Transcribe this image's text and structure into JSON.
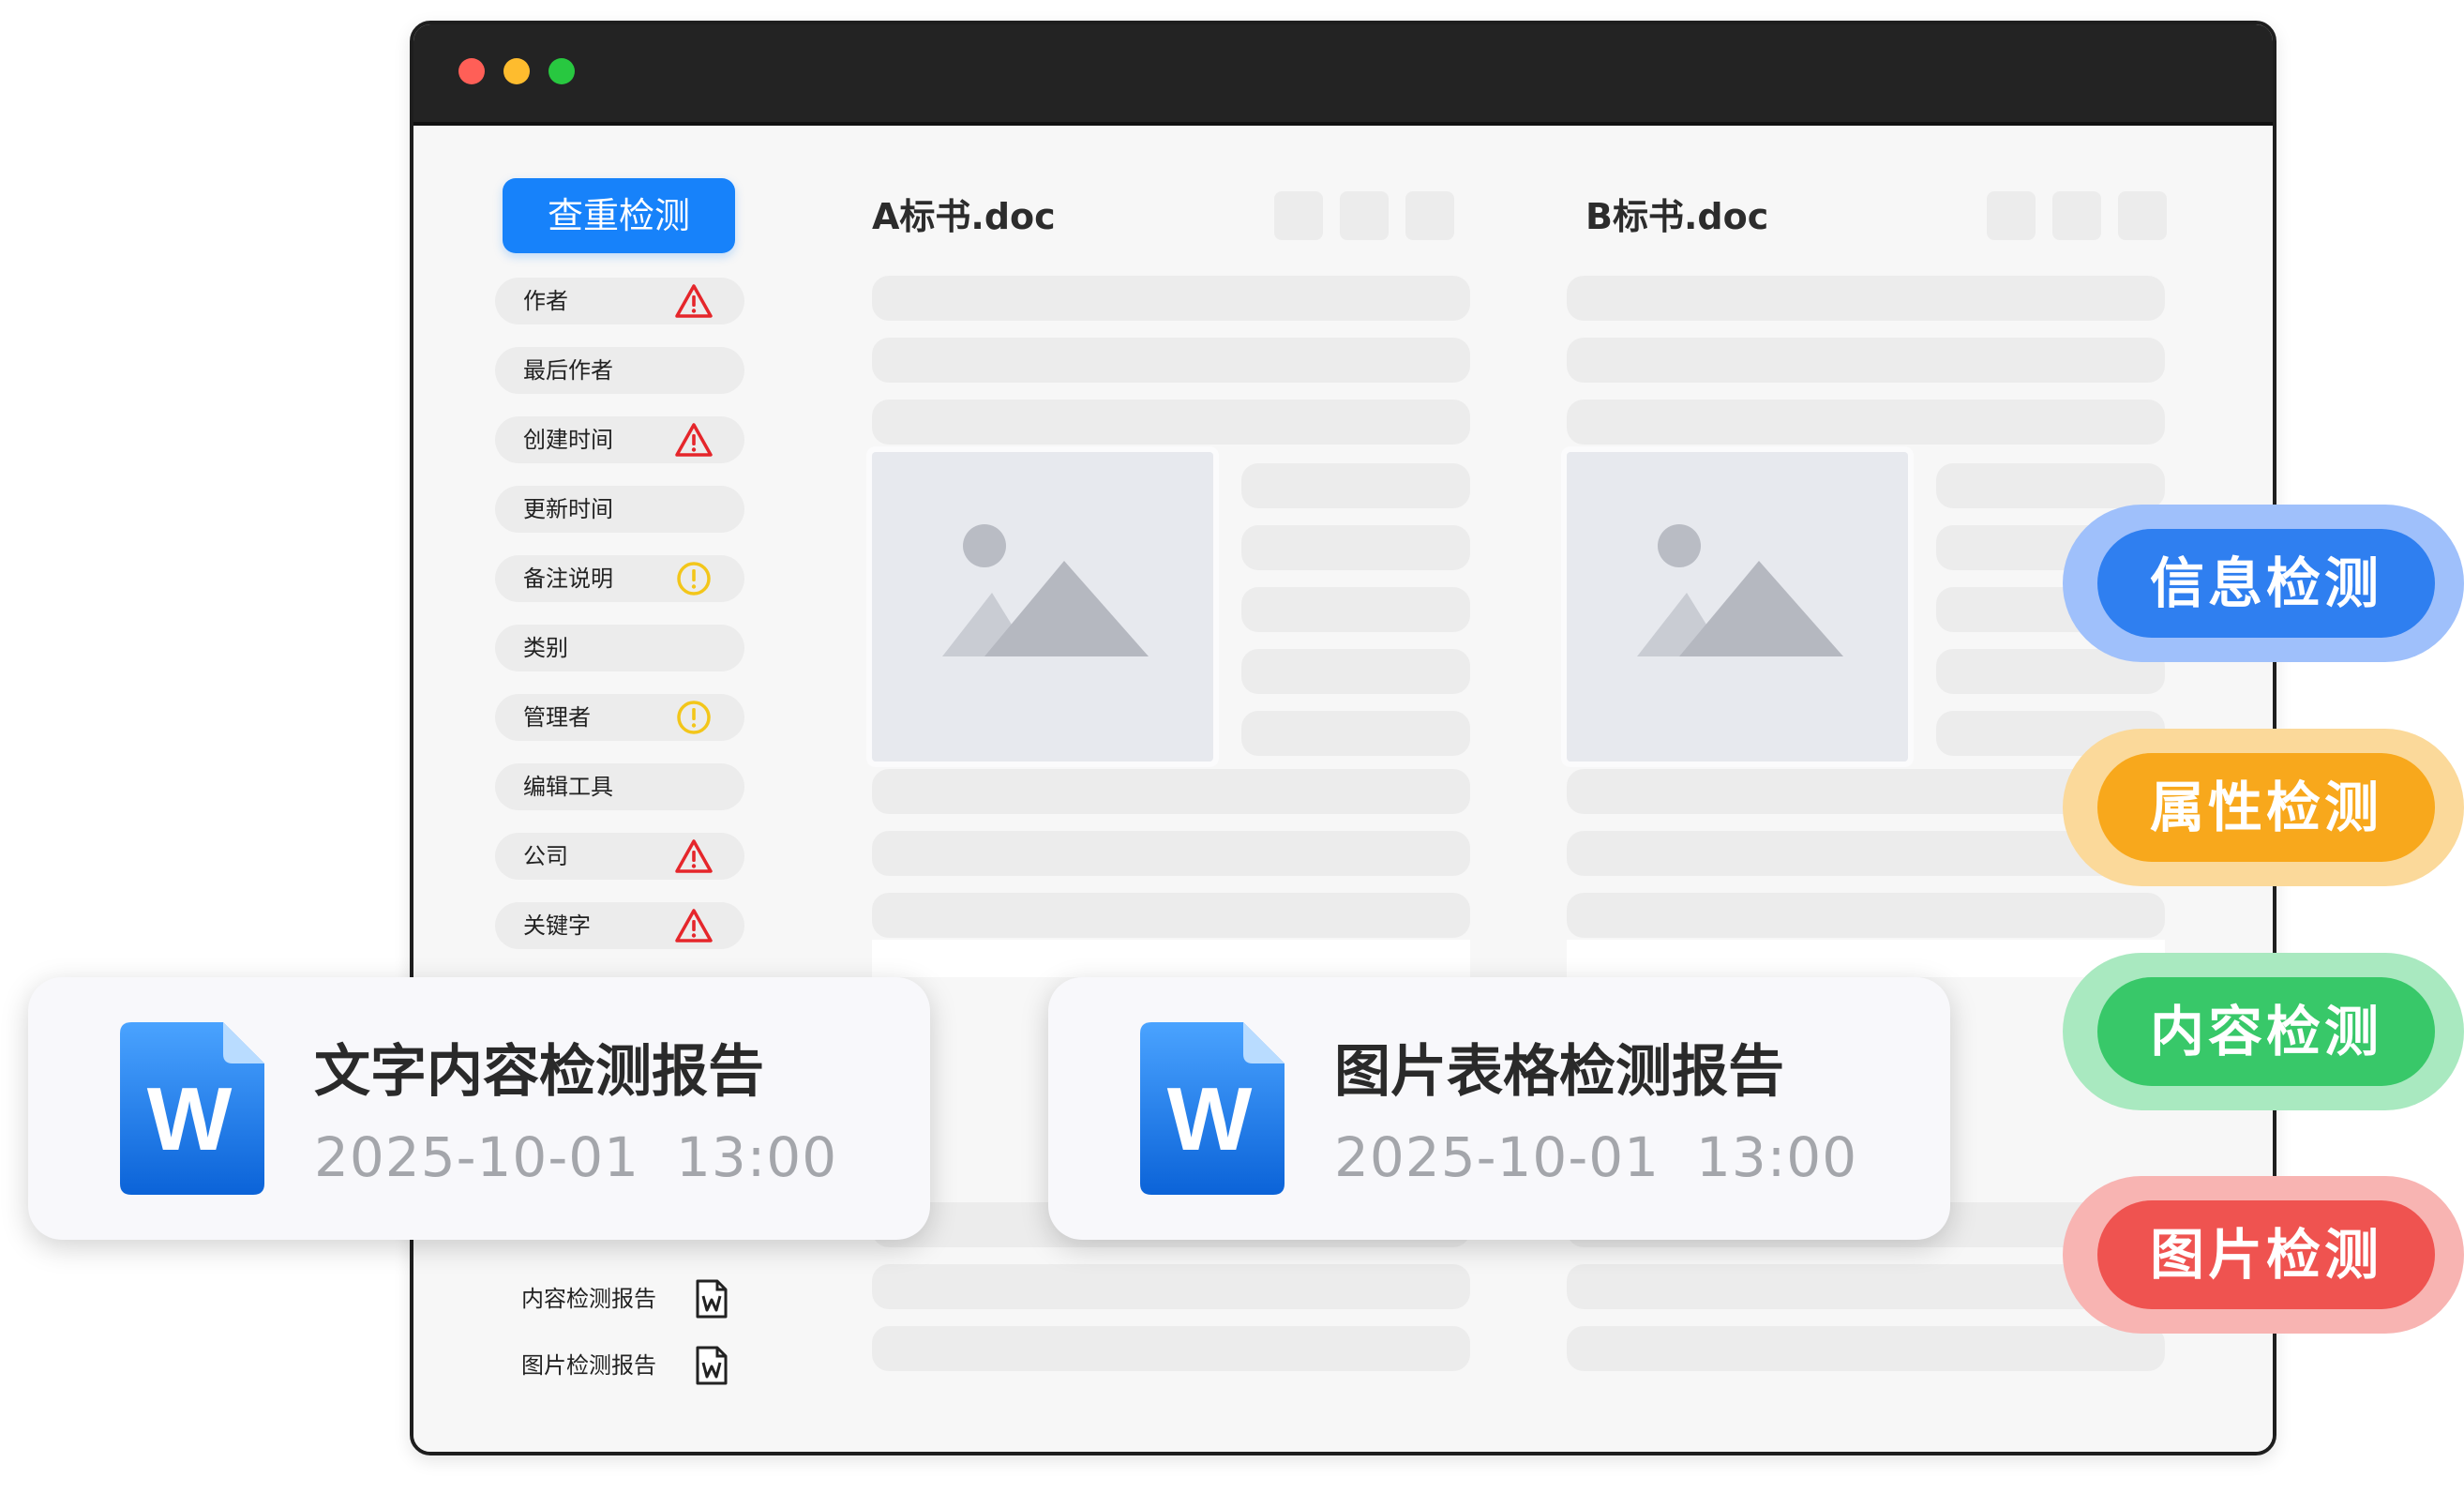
{
  "window": {
    "traffic_lights": [
      {
        "name": "close",
        "color": "#ff5f57"
      },
      {
        "name": "minimize",
        "color": "#febc2e"
      },
      {
        "name": "zoom",
        "color": "#28c840"
      }
    ]
  },
  "sidebar": {
    "check_button": "查重检测",
    "items": [
      {
        "label": "作者",
        "icon": "warning-triangle-icon",
        "status": "danger"
      },
      {
        "label": "最后作者",
        "icon": "",
        "status": ""
      },
      {
        "label": "创建时间",
        "icon": "warning-triangle-icon",
        "status": "danger"
      },
      {
        "label": "更新时间",
        "icon": "",
        "status": ""
      },
      {
        "label": "备注说明",
        "icon": "exclamation-circle-icon",
        "status": "warning"
      },
      {
        "label": "类别",
        "icon": "",
        "status": ""
      },
      {
        "label": "管理者",
        "icon": "exclamation-circle-icon",
        "status": "warning"
      },
      {
        "label": "编辑工具",
        "icon": "",
        "status": ""
      },
      {
        "label": "公司",
        "icon": "warning-triangle-icon",
        "status": "danger"
      },
      {
        "label": "关键字",
        "icon": "warning-triangle-icon",
        "status": "danger"
      }
    ],
    "reports": [
      {
        "label": "内容检测报告",
        "icon": "word-file-icon"
      },
      {
        "label": "图片检测报告",
        "icon": "word-file-icon"
      }
    ]
  },
  "documents": {
    "a": {
      "title": "A标书.doc"
    },
    "b": {
      "title": "B标书.doc"
    }
  },
  "report_cards": [
    {
      "title": "文字内容检测报告",
      "date": "2025-10-01",
      "time": "13:00",
      "icon": "word-document-icon"
    },
    {
      "title": "图片表格检测报告",
      "date": "2025-10-01",
      "time": "13:00",
      "icon": "word-document-icon"
    }
  ],
  "detection_badges": [
    {
      "label": "信息检测",
      "color": "#2f7ff0",
      "halo": "#9fc0fb"
    },
    {
      "label": "属性检测",
      "color": "#f8a81c",
      "halo": "#fbd99a"
    },
    {
      "label": "内容检测",
      "color": "#38c869",
      "halo": "#a9e9c0"
    },
    {
      "label": "图片检测",
      "color": "#ef5350",
      "halo": "#f8b4b2"
    }
  ],
  "colors": {
    "accent": "#1782fa",
    "danger": "#e5262b",
    "warning": "#f3c61a"
  }
}
